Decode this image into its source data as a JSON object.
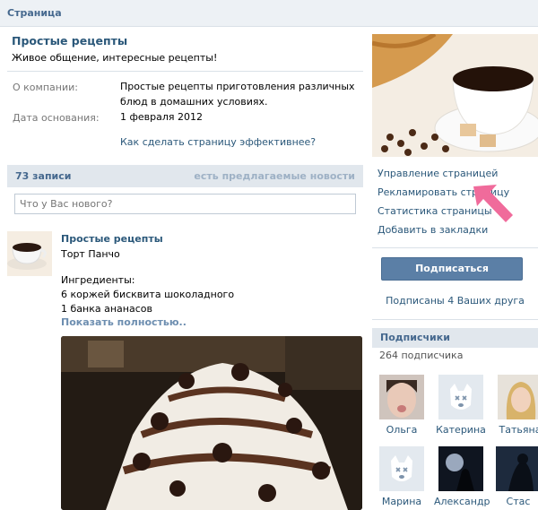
{
  "topbar": {
    "title": "Страница"
  },
  "page": {
    "name": "Простые рецепты",
    "status": "Живое общение, интересные рецепты!",
    "about_label": "О компании:",
    "about_value": "Простые рецепты приготовления различных блюд в домашних условиях.",
    "founded_label": "Дата основания:",
    "founded_value": "1 февраля 2012",
    "effective_link": "Как сделать страницу эффективнее?"
  },
  "wall": {
    "count": "73 записи",
    "suggested": "есть предлагаемые новости",
    "placeholder": "Что у Вас нового?"
  },
  "post": {
    "author": "Простые рецепты",
    "line1": "Торт Панчо",
    "line2": "Ингредиенты:",
    "line3": "6 коржей бисквита шоколадного",
    "line4": "1 банка ананасов",
    "more": "Показать полностью.."
  },
  "actions": {
    "manage": "Управление страницей",
    "advertise": "Рекламировать страницу",
    "stats": "Статистика страницы",
    "bookmark": "Добавить в закладки"
  },
  "subscribe": {
    "button": "Подписаться",
    "friends": "Подписаны 4 Ваших друга"
  },
  "subscribers": {
    "title": "Подписчики",
    "count": "264 подписчика",
    "people": [
      {
        "name": "Ольга",
        "icon": "photo"
      },
      {
        "name": "Катерина",
        "icon": "deactivated-dog-icon"
      },
      {
        "name": "Татьяна",
        "icon": "photo"
      },
      {
        "name": "Марина",
        "icon": "deactivated-dog-icon"
      },
      {
        "name": "Александр",
        "icon": "photo"
      },
      {
        "name": "Стас",
        "icon": "photo"
      }
    ]
  },
  "colors": {
    "link": "#2b587a",
    "header_bg": "#e1e7ed",
    "button": "#5b7fa6",
    "arrow": "#f06b9b"
  }
}
